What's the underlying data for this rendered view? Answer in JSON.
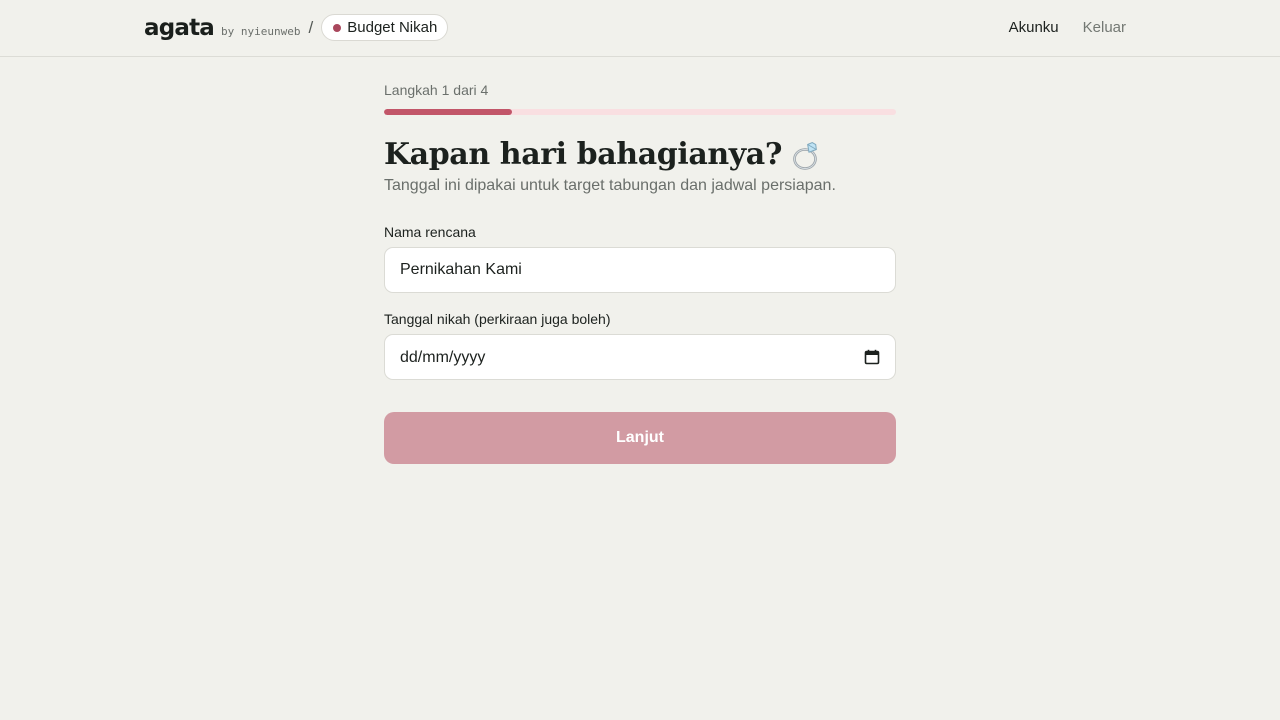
{
  "header": {
    "brand": "agata",
    "brand_by": "by nyieunweb",
    "separator": "/",
    "plan_name": "Budget Nikah",
    "account_link": "Akunku",
    "logout_link": "Keluar",
    "accent_dot_color": "#a9475c"
  },
  "progress": {
    "label": "Langkah 1 dari 4",
    "current_step": 1,
    "total_steps": 4,
    "fill_fraction": 0.25,
    "fill_color": "#c25669",
    "track_color": "#f9dfe1"
  },
  "form": {
    "title": "Kapan hari bahagianya?",
    "title_icon": "ring-icon",
    "subtitle": "Tanggal ini dipakai untuk target tabungan dan jadwal persiapan.",
    "plan_name_label": "Nama rencana",
    "plan_name_value": "Pernikahan Kami",
    "date_label": "Tanggal nikah (perkiraan juga boleh)",
    "date_placeholder": "dd/mm/yyyy",
    "date_icon": "calendar-icon",
    "submit_label": "Lanjut",
    "submit_color": "#d29ba3"
  }
}
